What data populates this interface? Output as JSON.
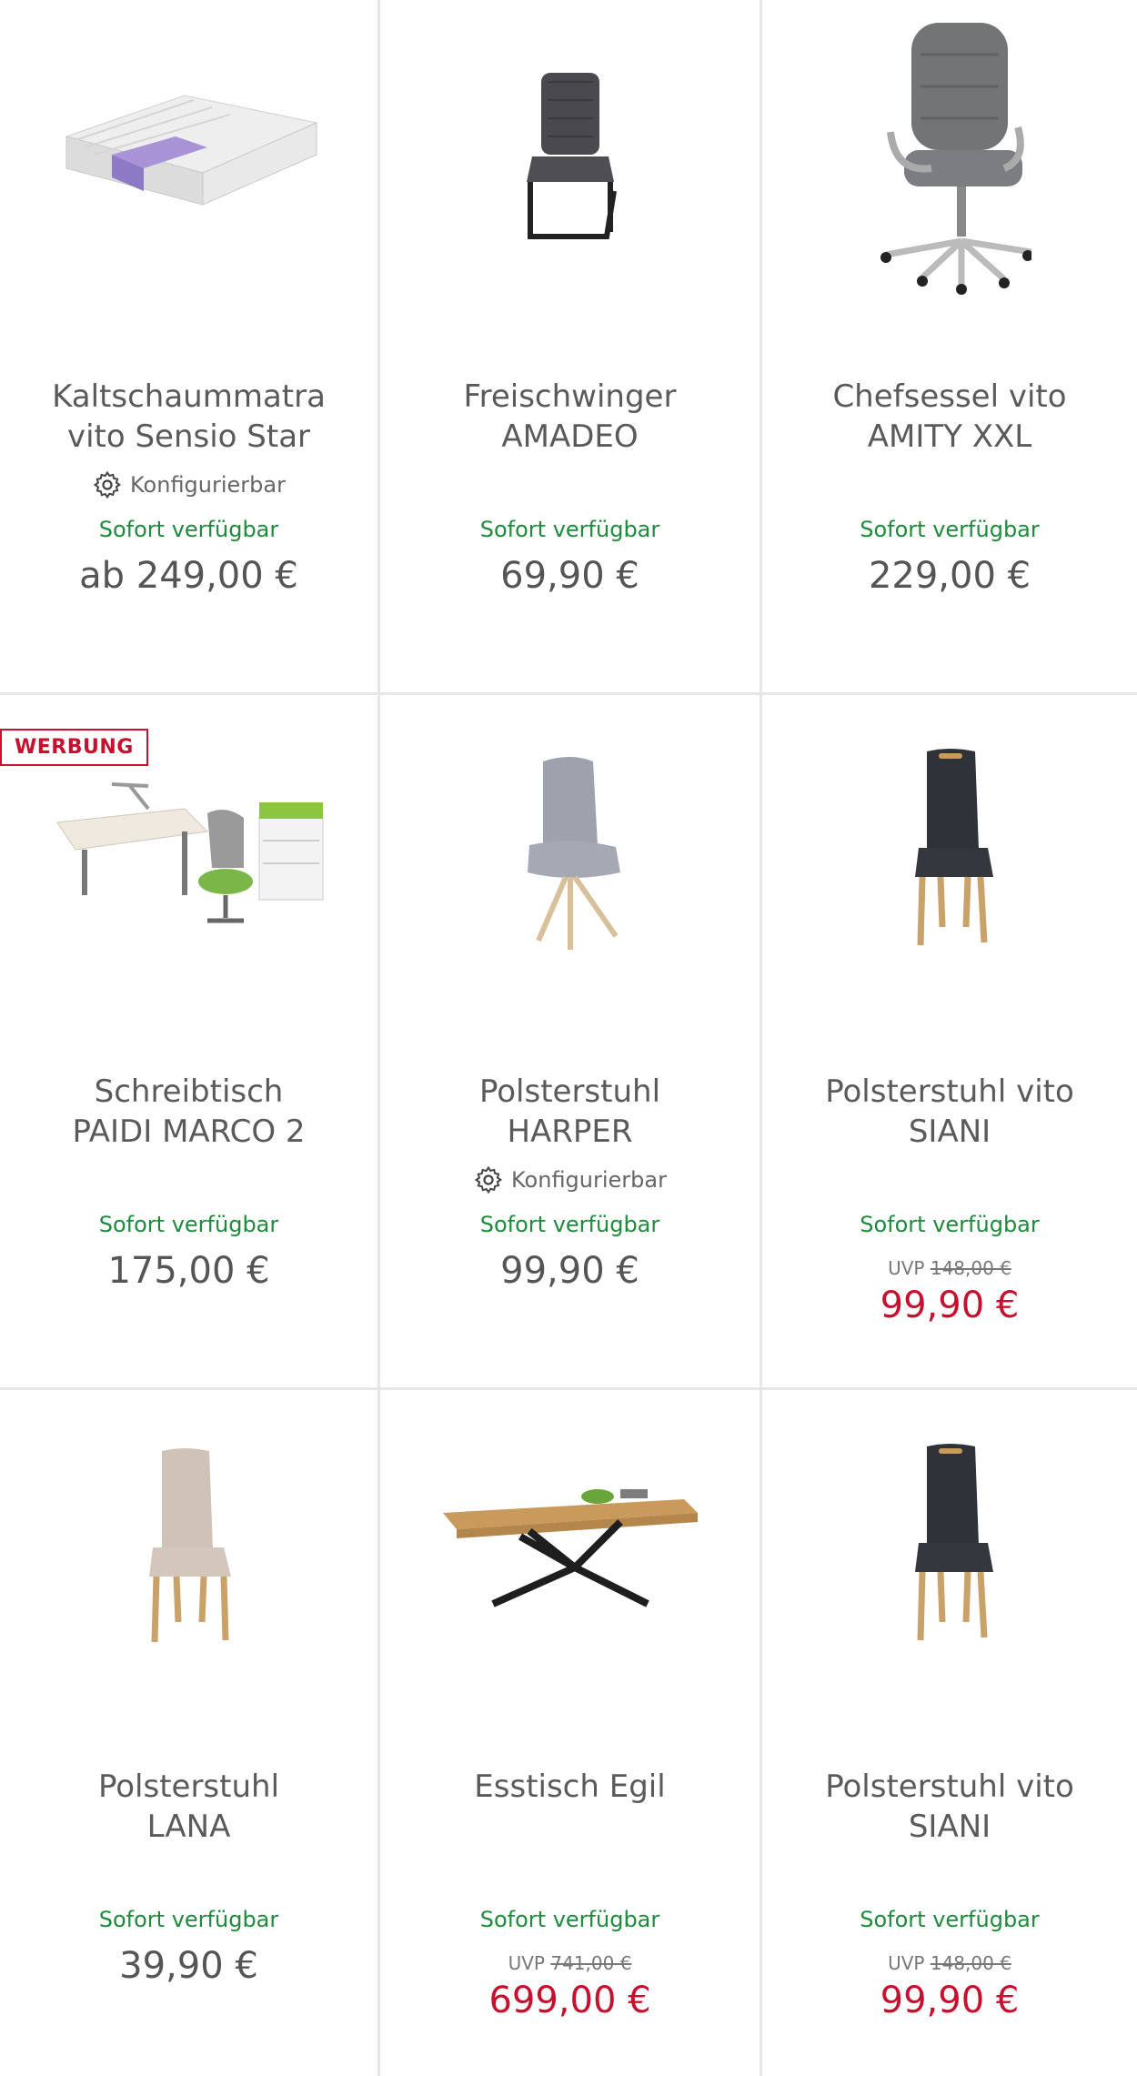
{
  "colors": {
    "available": "#1e8a3c",
    "sale_price": "#c8102e",
    "badge": "#c8102e",
    "text": "#555555",
    "divider": "#e6e6e6"
  },
  "products": [
    {
      "name_lines": [
        "Kaltschaummatra",
        "vito Sensio Star"
      ],
      "configurable": "Konfigurierbar",
      "availability": "Sofort verfügbar",
      "price": "ab 249,00 €",
      "image_icon": "mattress-image"
    },
    {
      "name_lines": [
        "Freischwinger",
        "AMADEO"
      ],
      "availability": "Sofort verfügbar",
      "price": "69,90 €",
      "image_icon": "cantilever-chair-image"
    },
    {
      "name_lines": [
        "Chefsessel vito",
        "AMITY XXL"
      ],
      "availability": "Sofort verfügbar",
      "price": "229,00 €",
      "image_icon": "office-chair-image"
    },
    {
      "badge": "WERBUNG",
      "name_lines": [
        "Schreibtisch",
        "PAIDI MARCO 2"
      ],
      "availability": "Sofort verfügbar",
      "price": "175,00 €",
      "image_icon": "desk-set-image"
    },
    {
      "name_lines": [
        "Polsterstuhl",
        "HARPER"
      ],
      "configurable": "Konfigurierbar",
      "availability": "Sofort verfügbar",
      "price": "99,90 €",
      "image_icon": "grey-chair-image"
    },
    {
      "name_lines": [
        "Polsterstuhl vito",
        "SIANI"
      ],
      "availability": "Sofort verfügbar",
      "uvp_label": "UVP",
      "uvp_price": "148,00 €",
      "sale_price": "99,90 €",
      "image_icon": "dark-chair-image"
    },
    {
      "name_lines": [
        "Polsterstuhl",
        "LANA"
      ],
      "availability": "Sofort verfügbar",
      "price": "39,90 €",
      "image_icon": "beige-chair-image"
    },
    {
      "name_lines": [
        "Esstisch Egil",
        ""
      ],
      "availability": "Sofort verfügbar",
      "uvp_label": "UVP",
      "uvp_price": "741,00 €",
      "sale_price": "699,00 €",
      "image_icon": "dining-table-image"
    },
    {
      "name_lines": [
        "Polsterstuhl vito",
        "SIANI"
      ],
      "availability": "Sofort verfügbar",
      "uvp_label": "UVP",
      "uvp_price": "148,00 €",
      "sale_price": "99,90 €",
      "image_icon": "dark-chair-image"
    }
  ]
}
